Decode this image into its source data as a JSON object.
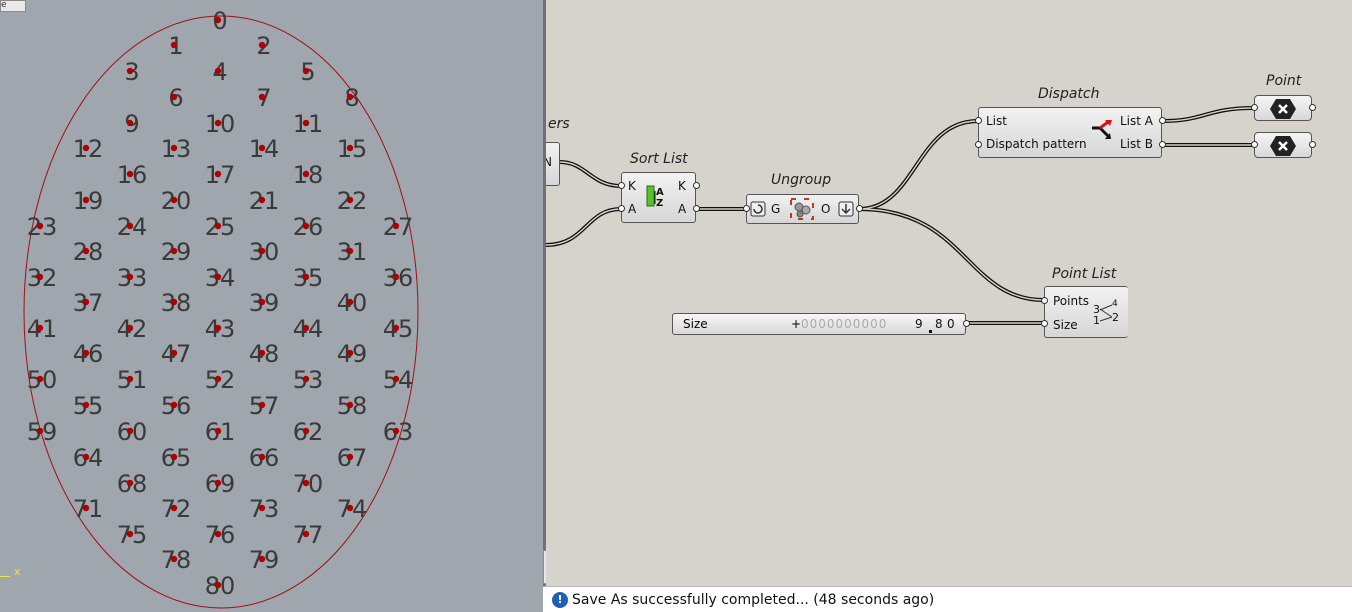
{
  "viewport": {
    "axis_label": "x",
    "corner_button": "e",
    "point_numbers": [
      "0",
      "1",
      "2",
      "3",
      "4",
      "5",
      "6",
      "7",
      "8",
      "9",
      "10",
      "11",
      "12",
      "13",
      "14",
      "15",
      "16",
      "17",
      "18",
      "19",
      "20",
      "21",
      "22",
      "23",
      "24",
      "25",
      "26",
      "27",
      "28",
      "29",
      "30",
      "31",
      "32",
      "33",
      "34",
      "35",
      "36",
      "37",
      "38",
      "39",
      "40",
      "41",
      "42",
      "43",
      "44",
      "45",
      "46",
      "47",
      "48",
      "49",
      "50",
      "51",
      "52",
      "53",
      "54",
      "55",
      "56",
      "57",
      "58",
      "59",
      "60",
      "61",
      "62",
      "63",
      "64",
      "65",
      "66",
      "67",
      "68",
      "69",
      "70",
      "71",
      "72",
      "73",
      "74",
      "75",
      "76",
      "77",
      "78",
      "79",
      "80"
    ]
  },
  "canvas": {
    "partial_component_label": "ers",
    "partial_component_port": "N",
    "sort_list": {
      "title": "Sort List",
      "in_k": "K",
      "in_a": "A",
      "out_k": "K",
      "out_a": "A"
    },
    "ungroup": {
      "title": "Ungroup",
      "in_g": "G",
      "out_o": "O"
    },
    "dispatch": {
      "title": "Dispatch",
      "in_list": "List",
      "in_pattern": "Dispatch pattern",
      "out_a": "List A",
      "out_b": "List B"
    },
    "point_a": {
      "title": "Point"
    },
    "point_b": {
      "title": "Point"
    },
    "point_list": {
      "title": "Point List",
      "in_points": "Points",
      "in_size": "Size"
    },
    "slider": {
      "label": "Size",
      "plus": "+",
      "digits": "0000000000",
      "val1": "9",
      "val2": "8",
      "val3": "0"
    }
  },
  "status": {
    "message": "Save As successfully completed... (48 seconds ago)",
    "icon": "info-icon"
  },
  "colors": {
    "viewport_bg": "#a0a6ae",
    "canvas_bg": "#d6d3cc",
    "point_color": "#b00000",
    "curve_color": "#a01010"
  }
}
